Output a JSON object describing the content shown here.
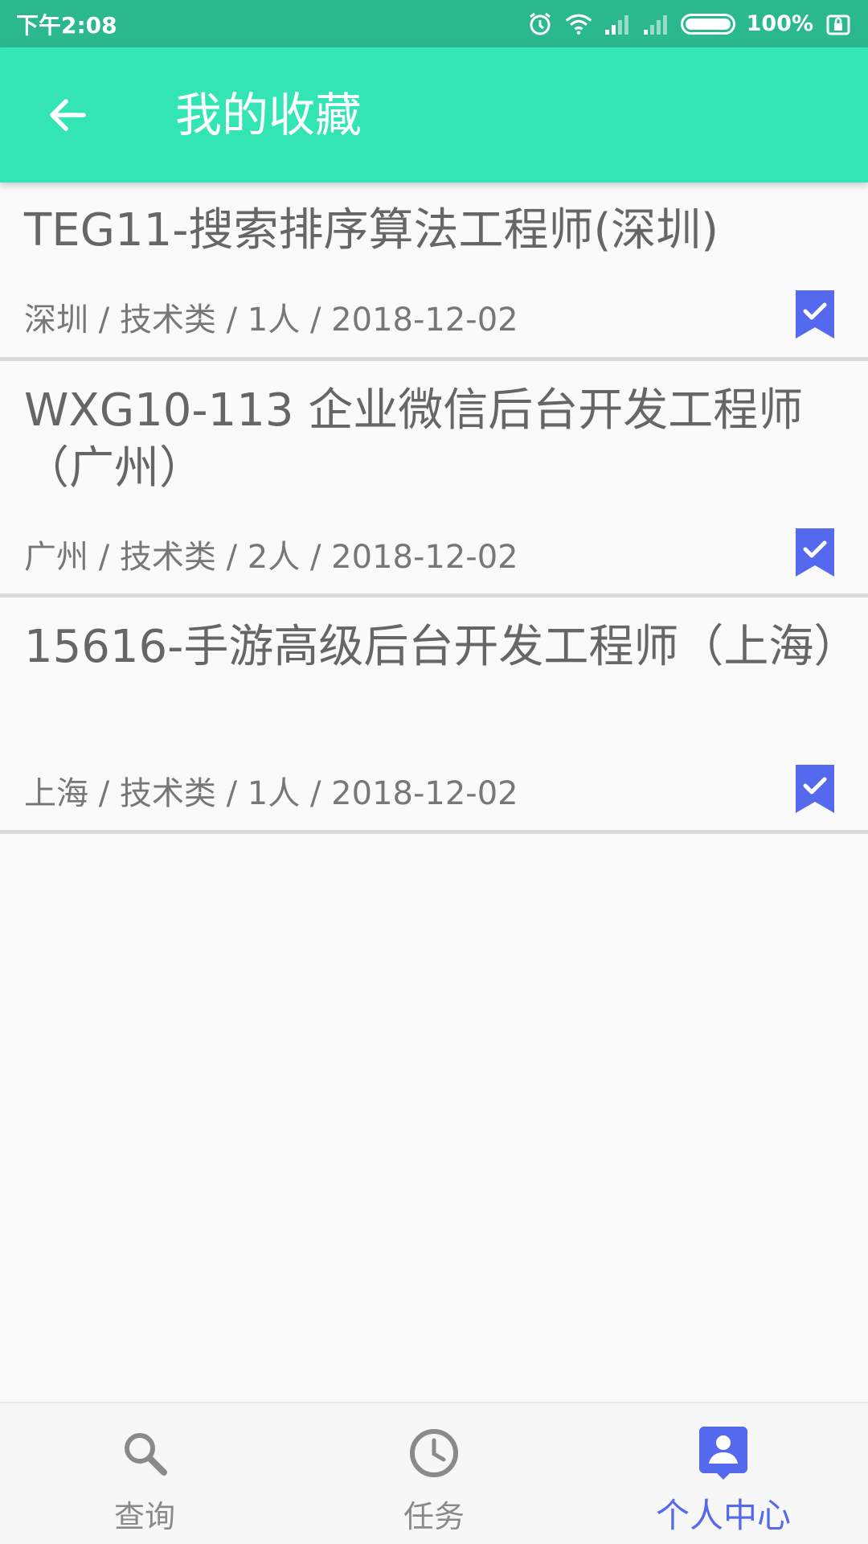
{
  "status_bar": {
    "time": "下午2:08",
    "battery_text": "100%",
    "icons": [
      "alarm-icon",
      "wifi-icon",
      "signal-icon",
      "signal-icon",
      "battery-icon",
      "lock-icon"
    ]
  },
  "app_bar": {
    "title": "我的收藏",
    "back_icon": "arrow-left-icon",
    "color": "#33e5b5"
  },
  "favorites": [
    {
      "title": "TEG11-搜索排序算法工程师(深圳)",
      "meta": "深圳 / 技术类 / 1人 / 2018-12-02",
      "bookmarked": true
    },
    {
      "title": "WXG10-113 企业微信后台开发工程师（广州）",
      "meta": "广州 / 技术类 / 2人 / 2018-12-02",
      "bookmarked": true
    },
    {
      "title": "15616-手游高级后台开发工程师（上海）",
      "meta": "上海 / 技术类 / 1人 / 2018-12-02",
      "bookmarked": true
    }
  ],
  "bottom_nav": {
    "items": [
      {
        "label": "查询",
        "icon": "search-icon",
        "active": false
      },
      {
        "label": "任务",
        "icon": "clock-icon",
        "active": false
      },
      {
        "label": "个人中心",
        "icon": "account-box-icon",
        "active": true
      }
    ],
    "active_color": "#5569ee",
    "inactive_color": "#8a8a8a"
  },
  "colors": {
    "status_bar": "#2bb88f",
    "bookmark": "#5569ee"
  }
}
